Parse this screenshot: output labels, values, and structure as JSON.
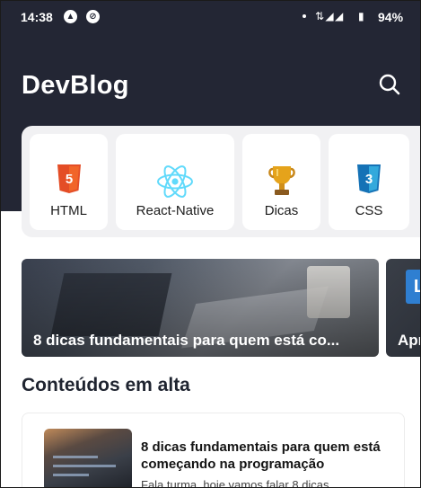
{
  "status_bar": {
    "time": "14:38",
    "battery": "94%"
  },
  "header": {
    "title": "DevBlog"
  },
  "categories": [
    {
      "label": "HTML",
      "icon": "html5-icon",
      "color": "#e44d26"
    },
    {
      "label": "React-Native",
      "icon": "react-icon",
      "color": "#61dafb"
    },
    {
      "label": "Dicas",
      "icon": "trophy-icon",
      "color": "#e5a31b"
    },
    {
      "label": "CSS",
      "icon": "css3-icon",
      "color": "#1572b6"
    }
  ],
  "featured": [
    {
      "caption": "8 dicas fundamentais para quem está co..."
    },
    {
      "caption": "Apr"
    }
  ],
  "trending": {
    "heading": "Conteúdos em alta",
    "items": [
      {
        "title": "8 dicas fundamentais para quem está começando na programação",
        "description": "Fala turma, hoje vamos falar 8 dicas"
      }
    ]
  },
  "colors": {
    "header_bg": "#232634",
    "accent_text": "#1f2430"
  }
}
